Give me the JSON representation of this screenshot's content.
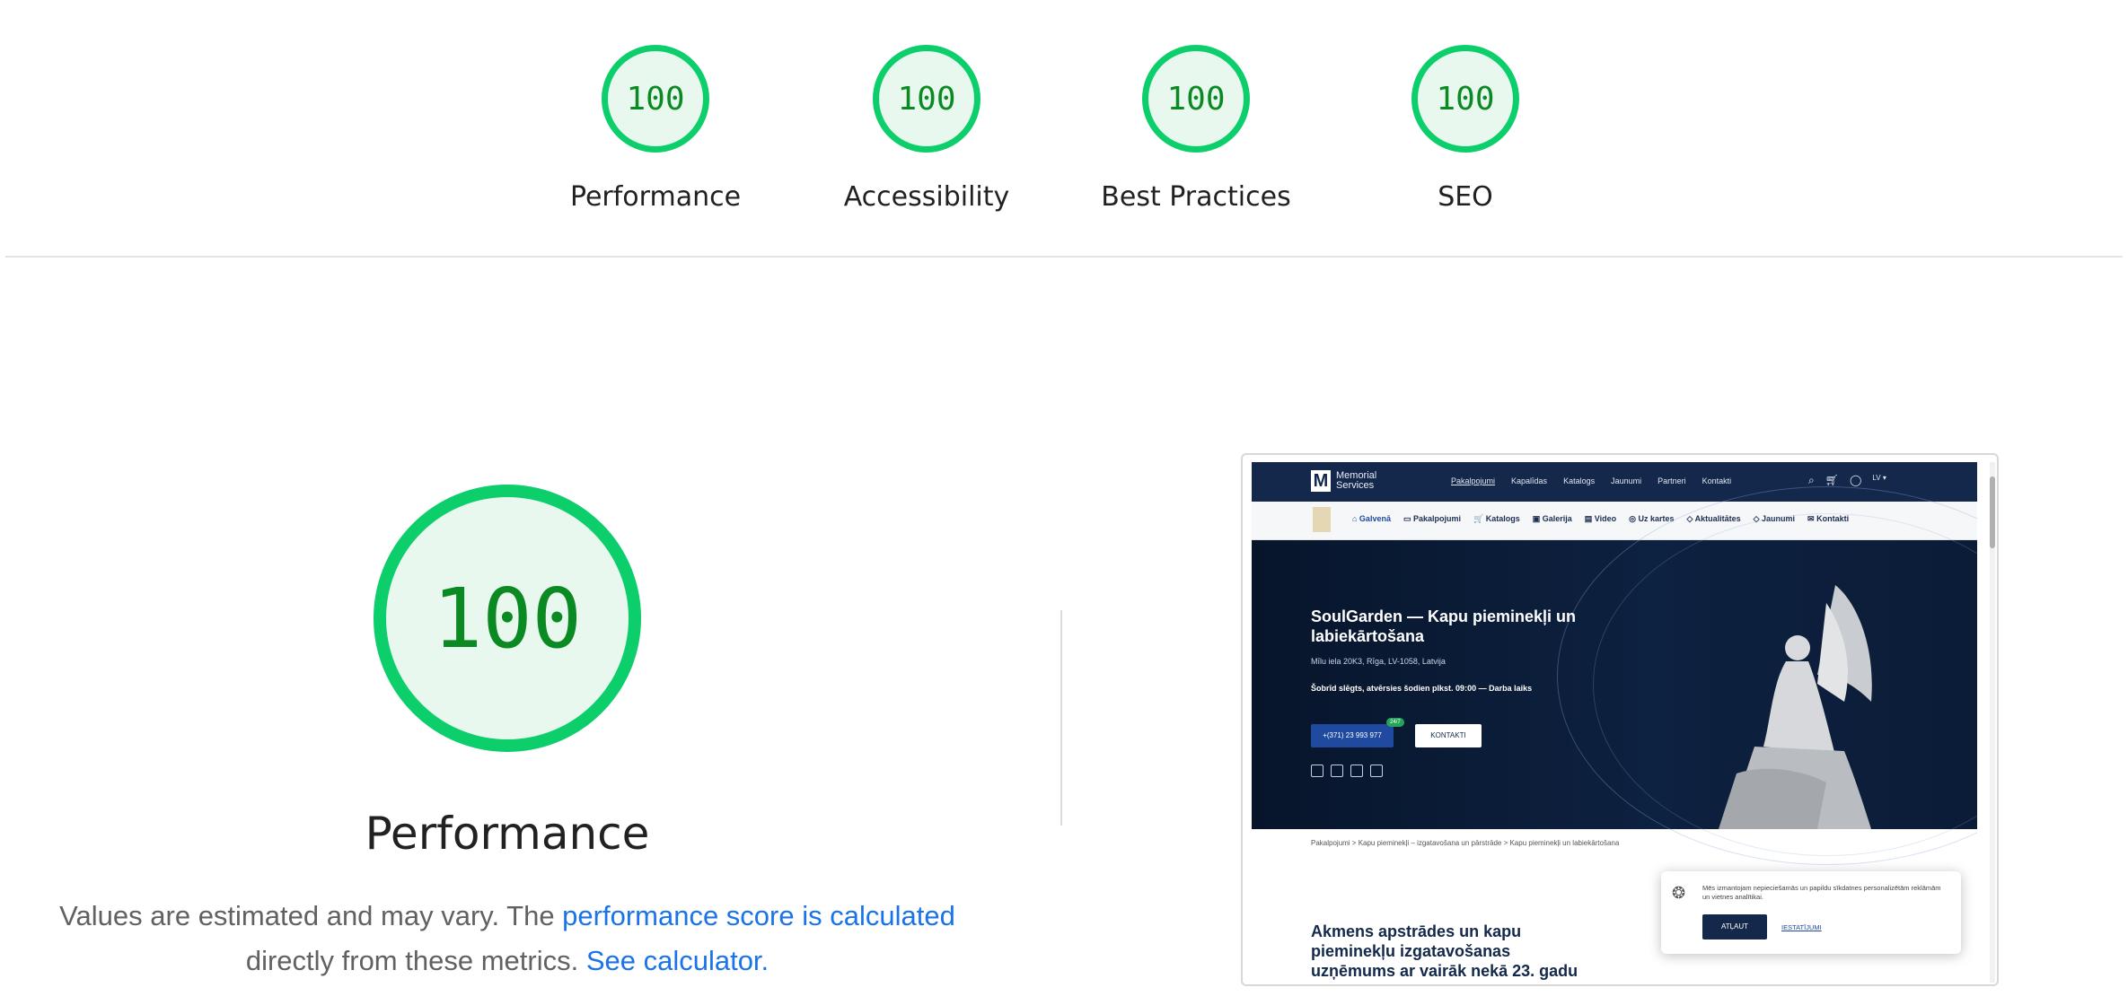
{
  "colors": {
    "pass_ring": "#0cce6b",
    "pass_fill": "#e8f8ee",
    "pass_text": "#0b8a24",
    "link": "#1a73e8"
  },
  "categories": [
    {
      "name": "Performance",
      "score": "100"
    },
    {
      "name": "Accessibility",
      "score": "100"
    },
    {
      "name": "Best Practices",
      "score": "100"
    },
    {
      "name": "SEO",
      "score": "100"
    }
  ],
  "performance_section": {
    "score": "100",
    "title": "Performance",
    "desc_prefix": "Values are estimated and may vary. The ",
    "link_score": "performance score is calculated",
    "desc_middle": "directly from these metrics. ",
    "link_calculator": "See calculator."
  },
  "screenshot": {
    "logo_text_line1": "Memorial",
    "logo_text_line2": "Services",
    "logo_mark": "M",
    "top_nav": [
      "Pakalpojumi",
      "Kapalīdas",
      "Katalogs",
      "Jaunumi",
      "Partneri",
      "Kontakti"
    ],
    "lang": "LV ▾",
    "sub_nav": [
      "⌂ Galvenā",
      "▭ Pakalpojumi",
      "🛒 Katalogs",
      "▣ Galerija",
      "▤ Video",
      "◎ Uz kartes",
      "◇ Aktualitātes",
      "◇ Jaunumi",
      "✉ Kontakti"
    ],
    "hero_title": "SoulGarden — Kapu pieminekļi un labiekārtošana",
    "hero_address": "Mīlu iela 20K3, Rīga, LV-1058, Latvija",
    "hero_hours": "Šobrīd slēgts,  atvērsies šodien plkst. 09:00 — Darba laiks",
    "phone_button": "+(371) 23 993 977",
    "phone_badge": "24/7",
    "contact_button": "KONTAKTI",
    "breadcrumbs": "Pakalpojumi  >  Kapu pieminekļi – izgatavošana un pārstrāde  >  Kapu pieminekļi un labiekārtošana",
    "section_heading": "Akmens apstrādes un kapu pieminekļu izgatavošanas uzņēmums ar vairāk nekā 23. gadu",
    "cookie_text": "Mēs izmantojam nepieciešamās un papildu sīkdatnes personalizētām reklāmām un vietnes analītikai.",
    "cookie_allow": "ATĻAUT",
    "cookie_settings": "IESTATĪJUMI"
  }
}
